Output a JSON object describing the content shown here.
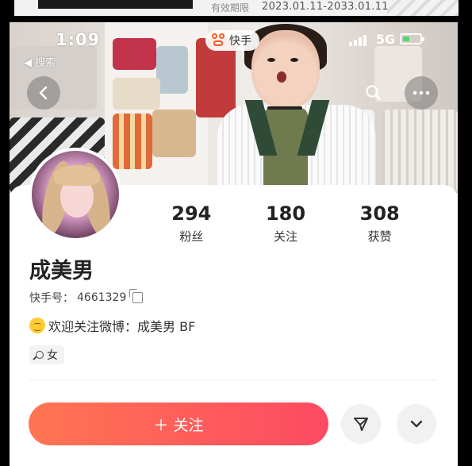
{
  "id_card": {
    "label": "有效期限",
    "value": "2023.01.11-2033.01.11"
  },
  "status_bar": {
    "time": "1:09",
    "network": "5G",
    "back_app": "◀ 搜索"
  },
  "app_badge": {
    "name": "快手"
  },
  "profile": {
    "stats": [
      {
        "value": "294",
        "label": "粉丝"
      },
      {
        "value": "180",
        "label": "关注"
      },
      {
        "value": "308",
        "label": "获赞"
      }
    ],
    "name": "成美男",
    "uid_label": "快手号：",
    "uid": "4661329",
    "bio": "欢迎关注微博：成美男 BF",
    "gender": "女"
  },
  "actions": {
    "follow": "＋ 关注"
  },
  "colors": {
    "follow_start": "#ff7552",
    "follow_end": "#fd4a62",
    "brand": "#ff5a1f"
  },
  "icons": [
    "back-arrow-icon",
    "search-icon",
    "more-icon",
    "copy-icon",
    "smile-emoji-icon",
    "gender-icon",
    "share-icon",
    "chevron-down-icon"
  ]
}
